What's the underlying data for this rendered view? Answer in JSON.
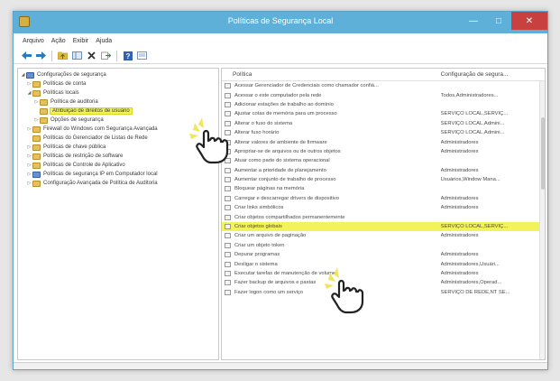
{
  "window": {
    "title": "Políticas de Segurança Local"
  },
  "window_controls": {
    "minimize": "—",
    "maximize": "□",
    "close": "✕"
  },
  "menu": [
    "Arquivo",
    "Ação",
    "Exibir",
    "Ajuda"
  ],
  "toolbar_icons": [
    "back-icon",
    "forward-icon",
    "up-folder-icon",
    "show-hide-tree-icon",
    "delete-icon",
    "export-icon",
    "help-icon",
    "properties-icon"
  ],
  "tree": [
    {
      "label": "Configurações de segurança",
      "twisty": "◢"
    },
    {
      "label": "Políticas de conta",
      "twisty": "▷"
    },
    {
      "label": "Políticas locais",
      "twisty": "◢"
    },
    {
      "label": "Política de auditoria",
      "twisty": "▷"
    },
    {
      "label": "Atribuição de direitos de usuário",
      "twisty": ""
    },
    {
      "label": "Opções de segurança",
      "twisty": "▷"
    },
    {
      "label": "Firewall do Windows com Segurança Avançada",
      "twisty": "▷"
    },
    {
      "label": "Políticas do Gerenciador de Listas de Rede",
      "twisty": ""
    },
    {
      "label": "Políticas de chave pública",
      "twisty": "▷"
    },
    {
      "label": "Políticas de restrição de software",
      "twisty": "▷"
    },
    {
      "label": "Políticas de Controle de Aplicativo",
      "twisty": "▷"
    },
    {
      "label": "Políticas de segurança IP em Computador local",
      "twisty": "▷"
    },
    {
      "label": "Configuração Avançada de Política de Auditoria",
      "twisty": "▷"
    }
  ],
  "columns": {
    "policy": "Política",
    "setting": "Configuração de segura..."
  },
  "rows": [
    {
      "policy": "Acessar Gerenciador de Credenciais como chamador confiá...",
      "setting": ""
    },
    {
      "policy": "Acessar o este computador pela rede",
      "setting": "Todos,Administradores..."
    },
    {
      "policy": "Adicionar estações de trabalho ao domínio",
      "setting": ""
    },
    {
      "policy": "Ajustar cotas de memória para um processo",
      "setting": "SERVIÇO LOCAL,SERVIÇ..."
    },
    {
      "policy": "Alterar o fuso do sistema",
      "setting": "SERVIÇO LOCAL,Admini..."
    },
    {
      "policy": "Alterar fuso horário",
      "setting": "SERVIÇO LOCAL,Admini..."
    },
    {
      "policy": "Alterar valores de ambiente de firmware",
      "setting": "Administradores"
    },
    {
      "policy": "Apropriar-se de arquivos ou de outros objetos",
      "setting": "Administradores"
    },
    {
      "policy": "Atuar como parte do sistema operacional",
      "setting": ""
    },
    {
      "policy": "Aumentar a prioridade de planejamento",
      "setting": "Administradores"
    },
    {
      "policy": "Aumentar conjunto de trabalho de processo",
      "setting": "Usuários,Window Mana..."
    },
    {
      "policy": "Bloquear páginas na memória",
      "setting": ""
    },
    {
      "policy": "Carregar e descarregar drivers de dispositivo",
      "setting": "Administradores"
    },
    {
      "policy": "Criar links simbólicos",
      "setting": "Administradores"
    },
    {
      "policy": "Criar objetos compartilhados permanentemente",
      "setting": ""
    },
    {
      "policy": "Criar objetos globais",
      "setting": "SERVIÇO LOCAL,SERVIÇ..."
    },
    {
      "policy": "Criar um arquivo de paginação",
      "setting": "Administradores"
    },
    {
      "policy": "Criar um objeto token",
      "setting": ""
    },
    {
      "policy": "Depurar programas",
      "setting": "Administradores"
    },
    {
      "policy": "Desligar o sistema",
      "setting": "Administradores,Usuári..."
    },
    {
      "policy": "Executar tarefas de manutenção de volume",
      "setting": "Administradores"
    },
    {
      "policy": "Fazer backup de arquivos e pastas",
      "setting": "Administradores,Operad..."
    },
    {
      "policy": "Fazer logon como um serviço",
      "setting": "SERVIÇO DE REDE,NT SE..."
    }
  ],
  "selected_tree_index": 4,
  "selected_row_index": 15,
  "colors": {
    "highlight": "#f2f25a",
    "titlebar": "#5fb0d8"
  }
}
